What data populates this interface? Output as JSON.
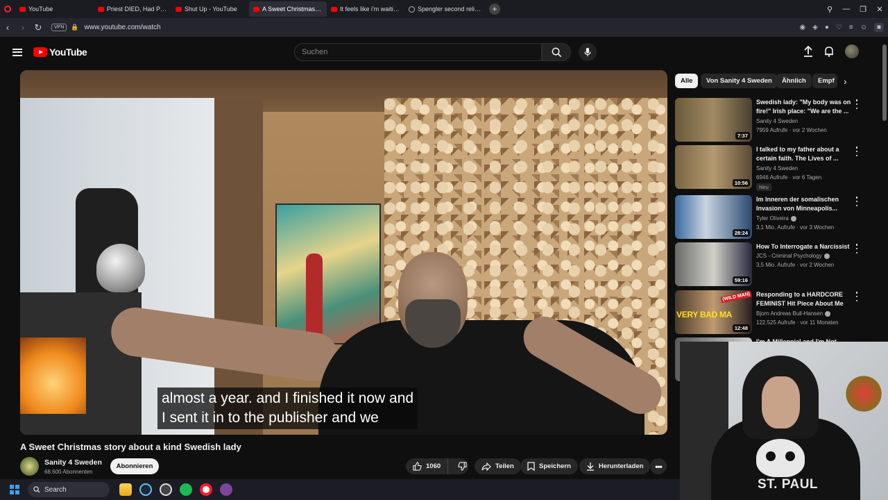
{
  "browser": {
    "tabs": [
      {
        "title": "YouTube",
        "active": false,
        "icon": "youtube-favicon"
      },
      {
        "title": "Priest DIED, Had PROFOUND",
        "active": false,
        "icon": "youtube-favicon"
      },
      {
        "title": "Shut Up - YouTube",
        "active": false,
        "icon": "youtube-favicon"
      },
      {
        "title": "A Sweet Christmas story a",
        "active": true,
        "icon": "youtube-favicon"
      },
      {
        "title": "It feels like i'm waiting to",
        "active": false,
        "icon": "youtube-favicon"
      },
      {
        "title": "Spengler second religious",
        "active": false,
        "icon": "globe-favicon"
      }
    ],
    "new_tab": "+",
    "vpn_label": "VPN",
    "url": "www.youtube.com/watch",
    "accent": "#ff1b2d"
  },
  "youtube": {
    "logo_text": "YouTube",
    "search_placeholder": "Suchen",
    "brand_color": "#ff0000"
  },
  "video": {
    "captions": [
      "almost a year. and I finished it now and",
      "I sent it in to the publisher and we"
    ],
    "title": "A Sweet Christmas story about a kind Swedish lady",
    "channel": {
      "name": "Sanity 4 Sweden",
      "subscribers": "68.600 Abonnenten"
    },
    "subscribe_label": "Abonnieren",
    "likes": "1060",
    "share_label": "Teilen",
    "save_label": "Speichern",
    "download_label": "Herunterladen"
  },
  "chips": [
    "Alle",
    "Von Sanity 4 Sweden",
    "Ähnlich",
    "Empf"
  ],
  "recommendations": [
    {
      "title": "Swedish lady: \"My body was on fire!\" Irish place: \"We are the ...",
      "channel": "Sanity 4 Sweden",
      "verified": false,
      "meta": "7959 Aufrufe · vor 2 Wochen",
      "duration": "7:37",
      "badge": ""
    },
    {
      "title": "I talked to my father about a certain faith. The Lives of ...",
      "channel": "Sanity 4 Sweden",
      "verified": false,
      "meta": "6946 Aufrufe · vor 6 Tagen",
      "duration": "10:56",
      "badge": "Neu"
    },
    {
      "title": "Im Inneren der somalischen Invasion von Minneapolis...",
      "channel": "Tyler Oliveira",
      "verified": true,
      "meta": "3,1 Mio. Aufrufe · vor 3 Wochen",
      "duration": "28:24",
      "badge": ""
    },
    {
      "title": "How To Interrogate a Narcissist",
      "channel": "JCS - Criminal Psychology",
      "verified": true,
      "meta": "3,5 Mio. Aufrufe · vor 2 Wochen",
      "duration": "59:16",
      "badge": ""
    },
    {
      "title": "Responding to a HARDCORE FEMINIST Hit Piece About Me",
      "channel": "Bjorn Andreas Bull-Hansen",
      "verified": true,
      "meta": "122.525 Aufrufe · vor 11 Monaten",
      "duration": "12:48",
      "badge": ""
    },
    {
      "title": "I'm A Millennial and I'm Not",
      "channel": "",
      "verified": false,
      "meta": "",
      "duration": "",
      "badge": ""
    }
  ],
  "thumb_overlays": {
    "very_bad_man": "VERY BAD MA",
    "wild_man": "(WILD MAN)"
  },
  "webcam": {
    "shirt_text": "ST. PAUL"
  },
  "taskbar": {
    "search_label": "Search"
  }
}
